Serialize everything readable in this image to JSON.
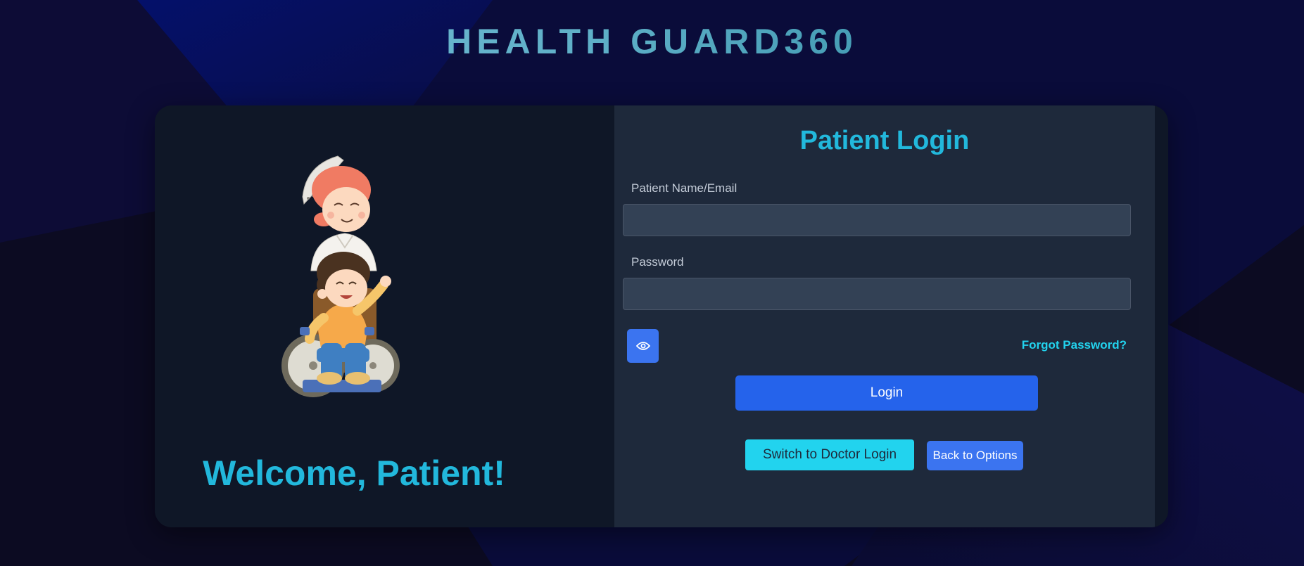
{
  "app": {
    "title": "HEALTH GUARD360"
  },
  "left_panel": {
    "illustration": "nurse-pushing-child-in-wheelchair",
    "welcome": "Welcome, Patient!"
  },
  "login_form": {
    "title": "Patient Login",
    "name_label": "Patient Name/Email",
    "name_value": "",
    "password_label": "Password",
    "password_value": "",
    "show_password_icon": "eye-icon",
    "forgot_password": "Forgot Password?",
    "login_button": "Login",
    "switch_button": "Switch to Doctor Login",
    "back_button": "Back to Options"
  },
  "colors": {
    "page_background": "#0c0b22",
    "accent_blue": "#2563eb",
    "accent_cyan": "#22d3ee",
    "heading_cyan": "#22b8dc",
    "card_left": "#0f1727",
    "card_right": "#1e293b",
    "input_background": "#334155"
  }
}
